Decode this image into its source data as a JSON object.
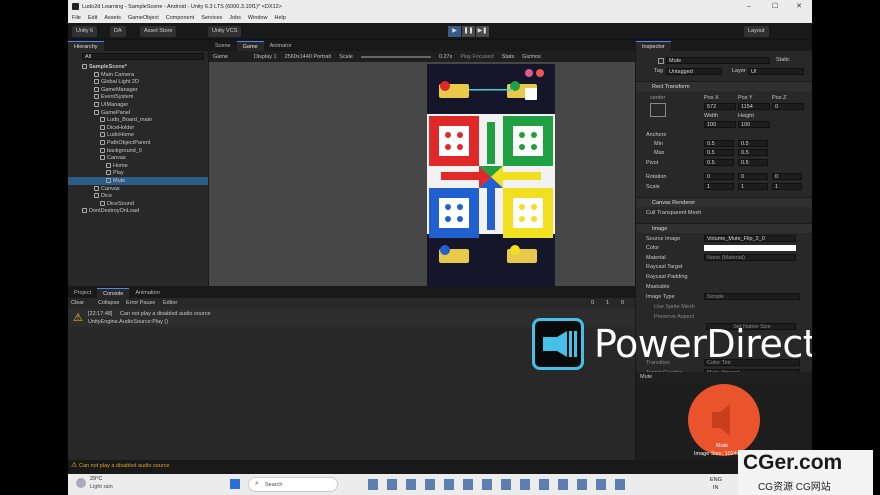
{
  "window": {
    "title": "Ludo2d Learning - SampleScene - Android - Unity 6.3 LTS (6000.3.10f1)* <DX12>"
  },
  "menu": [
    "File",
    "Edit",
    "Assets",
    "GameObject",
    "Component",
    "Services",
    "Jobs",
    "Window",
    "Help"
  ],
  "toolbar": {
    "unity": "Unity 6",
    "account": "DA",
    "asset_store": "Asset Store",
    "vcs": "Unity VCS",
    "layout": "Layout"
  },
  "hierarchy": {
    "tab": "Hierarchy",
    "search_placeholder": "All",
    "rows": [
      {
        "label": "SampleScene*",
        "indent": 0,
        "bold": true
      },
      {
        "label": "Main Camera",
        "indent": 2
      },
      {
        "label": "Global Light 2D",
        "indent": 2
      },
      {
        "label": "GameManager",
        "indent": 2
      },
      {
        "label": "EventSystem",
        "indent": 2
      },
      {
        "label": "UIManager",
        "indent": 2
      },
      {
        "label": "GamePanel",
        "indent": 2
      },
      {
        "label": "Ludo_Board_main",
        "indent": 3
      },
      {
        "label": "DiceHolder",
        "indent": 3
      },
      {
        "label": "LudoHome",
        "indent": 3
      },
      {
        "label": "PathObjectParent",
        "indent": 3
      },
      {
        "label": "background_0",
        "indent": 3
      },
      {
        "label": "Canvas",
        "indent": 3
      },
      {
        "label": "Home",
        "indent": 4
      },
      {
        "label": "Play",
        "indent": 4
      },
      {
        "label": "Mute",
        "indent": 4,
        "selected": true
      },
      {
        "label": "Canvas",
        "indent": 2
      },
      {
        "label": "Dice",
        "indent": 2
      },
      {
        "label": "DiceSound",
        "indent": 3
      },
      {
        "label": "DontDestroyOnLoad",
        "indent": 0
      }
    ]
  },
  "scene_tabs": [
    "Scene",
    "Game",
    "Animator"
  ],
  "game_bar": {
    "mode": "Game",
    "display": "Display 1",
    "resolution": "2560x1440 Portrait",
    "scale_label": "Scale",
    "scale_value": "0.27x",
    "play_focused": "Play Focused",
    "stats": "Stats",
    "gizmos": "Gizmos"
  },
  "bottom_tabs": [
    "Project",
    "Console",
    "Animation"
  ],
  "console": {
    "buttons": [
      "Clear",
      "Collapse",
      "Error Pause",
      "Editor"
    ],
    "counts": [
      "0",
      "1",
      "0"
    ],
    "entries": [
      {
        "time": "[22:17:48]",
        "msg": "Can not play a disabled audio source",
        "detail": "UnityEngine.AudioSource:Play ()"
      }
    ],
    "status": "Can not play a disabled audio source"
  },
  "inspector": {
    "tab": "Inspector",
    "object_name": "Mute",
    "static": "Static",
    "tag_label": "Tag",
    "tag": "Untagged",
    "layer_label": "Layer",
    "layer": "UI",
    "rect": {
      "title": "Rect Transform",
      "anchor_mode": "center",
      "posx_label": "Pos X",
      "posy_label": "Pos Y",
      "posz_label": "Pos Z",
      "posx": "572",
      "posy": "1154",
      "posz": "0",
      "width_label": "Width",
      "height_label": "Height",
      "width": "100",
      "height": "100",
      "anchors": "Anchors",
      "min": "Min",
      "max": "Max",
      "pivot": "Pivot",
      "rotation": "Rotation",
      "scale": "Scale",
      "min_x": "0.5",
      "min_y": "0.5",
      "max_x": "0.5",
      "max_y": "0.5",
      "pivot_x": "0.5",
      "pivot_y": "0.5",
      "rot_x": "0",
      "rot_y": "0",
      "rot_z": "0",
      "scale_x": "1",
      "scale_y": "1",
      "scale_z": "1"
    },
    "canvas_renderer": {
      "title": "Canvas Renderer",
      "cull": "Cull Transparent Mesh"
    },
    "image": {
      "title": "Image",
      "source_label": "Source Image",
      "source": "Volume_Mute_Flip_2_0",
      "color_label": "Color",
      "material_label": "Material",
      "material": "None (Material)",
      "raycast_target": "Raycast Target",
      "raycast_padding": "Raycast Padding",
      "maskable": "Maskable",
      "image_type_label": "Image Type",
      "image_type": "Simple",
      "use_sprite_mesh": "Use Sprite Mesh",
      "preserve_aspect": "Preserve Aspect",
      "set_native": "Set Native Size"
    },
    "hidden_rows": [
      "Transition",
      "Target Graphic"
    ],
    "transition_value": "Color Tint",
    "target_value": "Mute (Image)",
    "preview_label": "Mute",
    "preview_caption": "Mute",
    "preview_size": "Image Size: 1024x1024"
  },
  "overlay": {
    "brand": "PowerDirector"
  },
  "watermark": {
    "main": "CGer.com",
    "sub": "CG资源  CG网站"
  },
  "taskbar": {
    "temp": "29°C",
    "weather": "Light rain",
    "search": "Search",
    "lang1": "ENG",
    "lang2": "IN"
  },
  "colors": {
    "red": "#e02828",
    "green": "#20a040",
    "yellow": "#f0e020",
    "blue": "#2060d0",
    "accent": "#4a8af0"
  }
}
